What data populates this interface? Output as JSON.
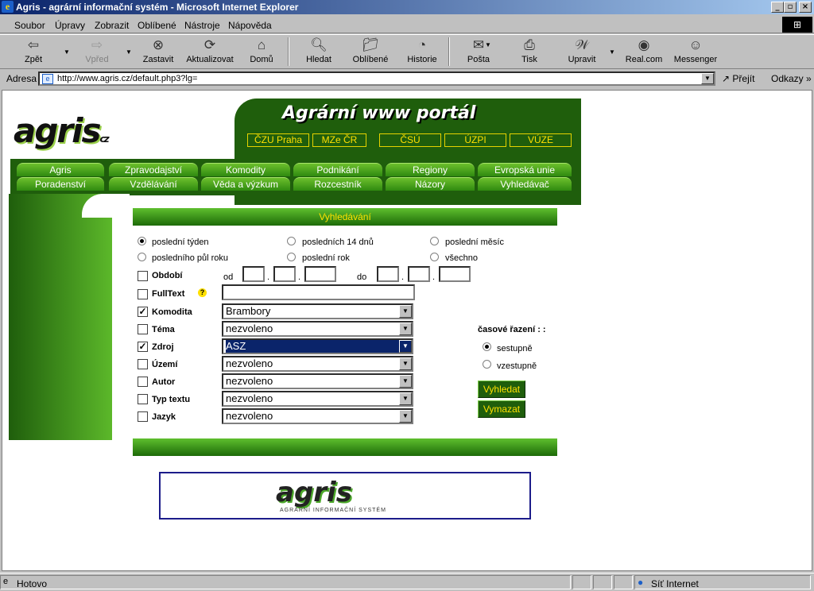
{
  "window": {
    "title": "Agris - agrární informační systém - Microsoft Internet Explorer"
  },
  "menu": [
    "Soubor",
    "Úpravy",
    "Zobrazit",
    "Oblíbené",
    "Nástroje",
    "Nápověda"
  ],
  "toolbar": [
    {
      "label": "Zpět",
      "icon": "back-arrow-icon"
    },
    {
      "label": "Vpřed",
      "icon": "forward-arrow-icon"
    },
    {
      "label": "Zastavit",
      "icon": "stop-icon"
    },
    {
      "label": "Aktualizovat",
      "icon": "refresh-icon"
    },
    {
      "label": "Domů",
      "icon": "home-icon"
    },
    {
      "label": "Hledat",
      "icon": "search-icon"
    },
    {
      "label": "Oblíbené",
      "icon": "favorites-icon"
    },
    {
      "label": "Historie",
      "icon": "history-icon"
    },
    {
      "label": "Pošta",
      "icon": "mail-icon"
    },
    {
      "label": "Tisk",
      "icon": "print-icon"
    },
    {
      "label": "Upravit",
      "icon": "edit-icon"
    },
    {
      "label": "Real.com",
      "icon": "realcom-icon"
    },
    {
      "label": "Messenger",
      "icon": "messenger-icon"
    }
  ],
  "address": {
    "label": "Adresa",
    "url": "http://www.agris.cz/default.php3?lg=",
    "go": "Přejít",
    "links": "Odkazy"
  },
  "site": {
    "logo": "agris",
    "logo_suffix": "cz",
    "portal_title": "Agrární www portál",
    "top_links": [
      "ČZU Praha",
      "MZe ČR",
      "ČSÚ",
      "ÚZPI",
      "VÚZE"
    ],
    "nav_row1": [
      "Agris",
      "Zpravodajství",
      "Komodity",
      "Podnikání",
      "Regiony",
      "Evropská unie"
    ],
    "nav_row2": [
      "Poradenství",
      "Vzdělávání",
      "Věda a výzkum",
      "Rozcestník",
      "Názory",
      "Vyhledávač"
    ]
  },
  "search": {
    "title": "Vyhledávání",
    "periods": [
      {
        "label": "poslední týden",
        "selected": true
      },
      {
        "label": "posledních 14 dnů",
        "selected": false
      },
      {
        "label": "poslední měsíc",
        "selected": false
      },
      {
        "label": "posledního půl roku",
        "selected": false
      },
      {
        "label": "poslední rok",
        "selected": false
      },
      {
        "label": "všechno",
        "selected": false
      }
    ],
    "obdobi": {
      "label": "Období",
      "od": "od",
      "do": "do"
    },
    "fulltext": {
      "label": "FullText",
      "help": "?"
    },
    "filters": [
      {
        "label": "Komodita",
        "checked": true,
        "value": "Brambory"
      },
      {
        "label": "Téma",
        "checked": false,
        "value": "nezvoleno"
      },
      {
        "label": "Zdroj",
        "checked": true,
        "value": "ASZ"
      },
      {
        "label": "Území",
        "checked": false,
        "value": "nezvoleno"
      },
      {
        "label": "Autor",
        "checked": false,
        "value": "nezvoleno"
      },
      {
        "label": "Typ textu",
        "checked": false,
        "value": "nezvoleno"
      },
      {
        "label": "Jazyk",
        "checked": false,
        "value": "nezvoleno"
      }
    ],
    "sort": {
      "label": "časové řazení : :",
      "options": [
        "sestupně",
        "vzestupně"
      ]
    },
    "buttons": {
      "search": "Vyhledat",
      "clear": "Vymazat"
    }
  },
  "footer_logo": {
    "name": "agris",
    "tagline": "AGRÁRNÍ INFORMAČNÍ SYSTÉM"
  },
  "status": {
    "text": "Hotovo",
    "zone": "Síť Internet"
  }
}
